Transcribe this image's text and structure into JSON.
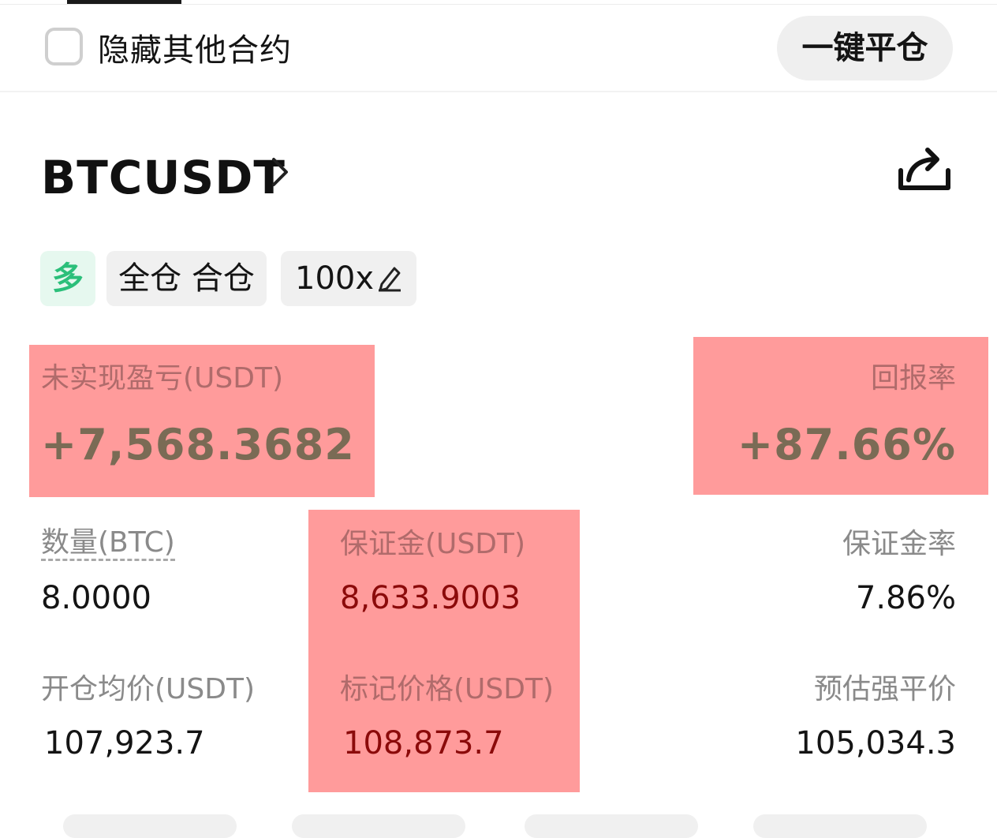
{
  "header": {
    "hide_other_contracts": "隐藏其他合约",
    "hide_checked": false,
    "close_all_label": "一键平仓"
  },
  "position": {
    "symbol": "BTCUSDT",
    "tags": {
      "side": "多",
      "margin_mode": "全仓 合仓",
      "leverage": "100x"
    },
    "unrealized_pnl_label": "未实现盈亏(USDT)",
    "unrealized_pnl_value": "+7,568.3682",
    "roe_label": "回报率",
    "roe_value": "+87.66%",
    "quantity_label": "数量(BTC)",
    "quantity_value": "8.0000",
    "margin_label": "保证金(USDT)",
    "margin_value": "8,633.9003",
    "margin_rate_label": "保证金率",
    "margin_rate_value": "7.86%",
    "entry_price_label": "开仓均价(USDT)",
    "entry_price_value": "107,923.7",
    "mark_price_label": "标记价格(USDT)",
    "mark_price_value": "108,873.7",
    "liq_price_label": "预估强平价",
    "liq_price_value": "105,034.3"
  },
  "colors": {
    "long_green": "#2bbf7a",
    "highlight": "#ff9b9b",
    "value_red": "#8b0a0a"
  },
  "icons": [
    "chevron-right-icon",
    "share-icon",
    "edit-pencil-icon",
    "checkbox-icon"
  ]
}
